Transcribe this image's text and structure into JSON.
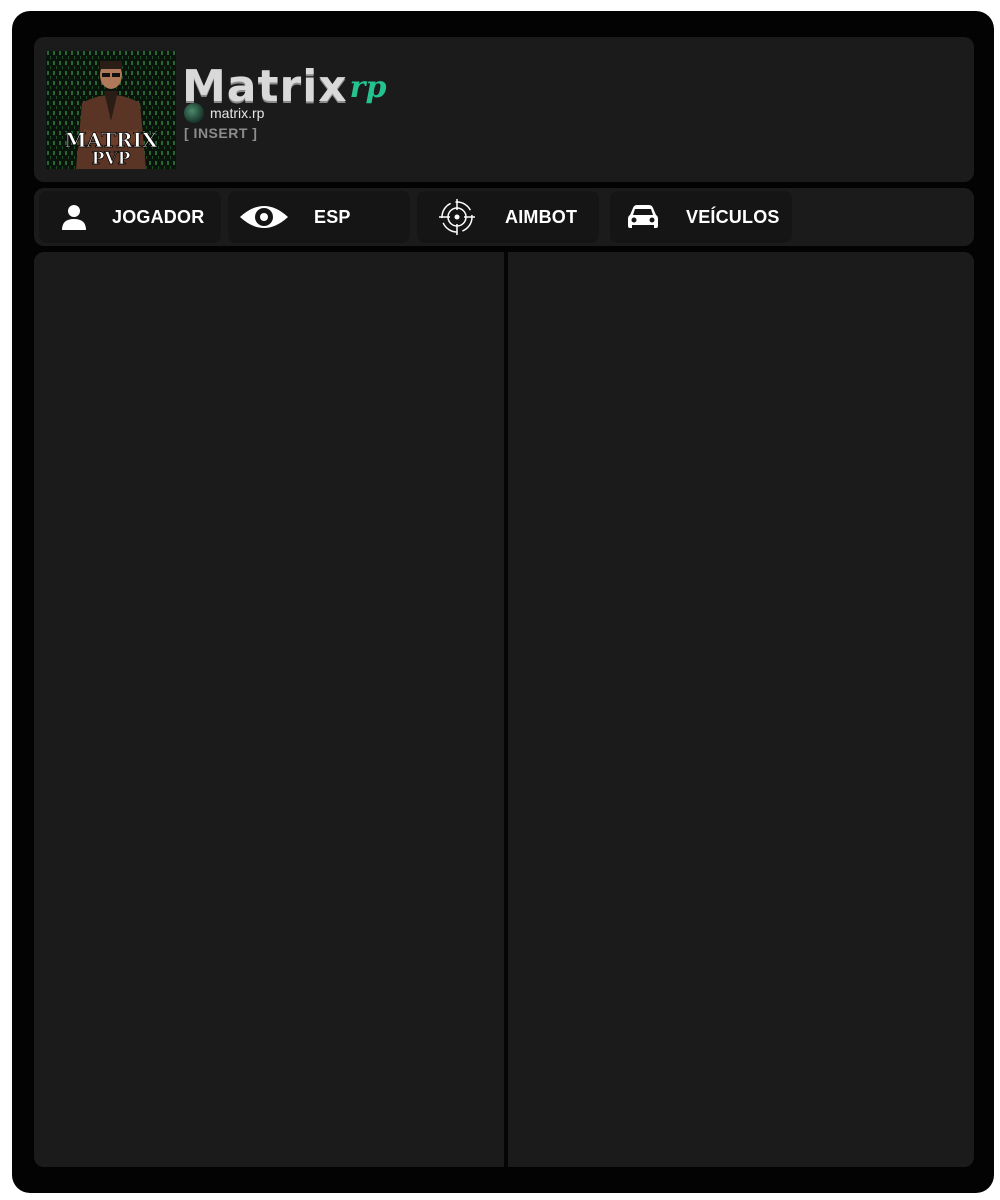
{
  "brand": {
    "logo_main": "Matrix",
    "logo_sub": "rp",
    "poster_line1": "MATRIX",
    "poster_line2": "PVP",
    "subline": "matrix.rp",
    "hotkey": "[  INSERT ]",
    "accent": "#23c28e"
  },
  "tabs": [
    {
      "label": "JOGADOR",
      "icon": "person-icon"
    },
    {
      "label": "ESP",
      "icon": "eye-icon"
    },
    {
      "label": "AIMBOT",
      "icon": "crosshair-icon"
    },
    {
      "label": "VEÍCULOS",
      "icon": "car-icon"
    }
  ],
  "colors": {
    "window_bg": "#030303",
    "panel_bg": "#1b1b1b",
    "tab_bg": "#151515",
    "text": "#ffffff"
  }
}
